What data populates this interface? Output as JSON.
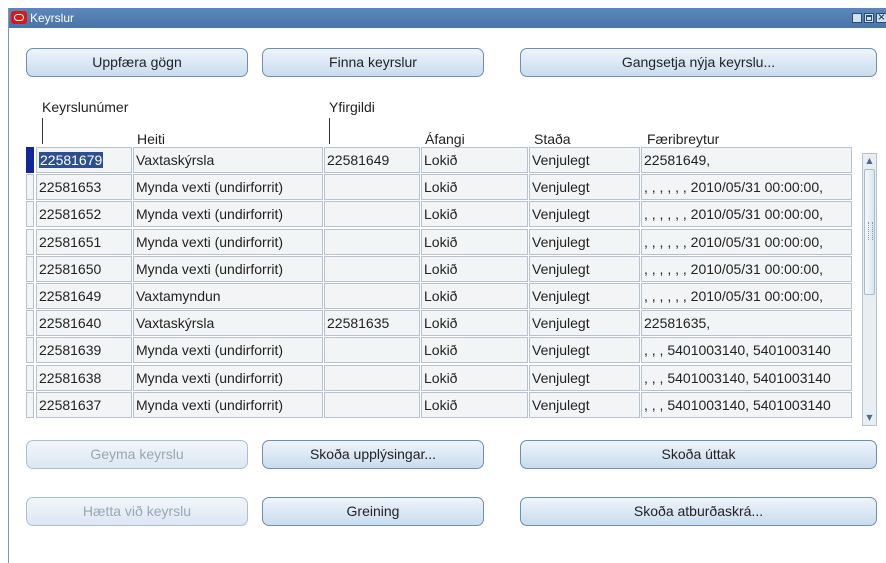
{
  "window": {
    "title": "Keyrslur"
  },
  "top_buttons": {
    "refresh": "Uppfæra gögn",
    "find": "Finna keyrslur",
    "submit_new": "Gangsetja nýja keyrslu..."
  },
  "columns": {
    "request_id": "Keyrslunúmer",
    "name": "Heiti",
    "parent": "Yfirgildi",
    "phase": "Áfangi",
    "status": "Staða",
    "parameters": "Færibreytur"
  },
  "rows": [
    {
      "id": "22581679",
      "name": "Vaxtaskýrsla",
      "parent": "22581649",
      "phase": "Lokið",
      "status": "Venjulegt",
      "params": "22581649,"
    },
    {
      "id": "22581653",
      "name": "Mynda vexti (undirforrit)",
      "parent": "",
      "phase": "Lokið",
      "status": "Venjulegt",
      "params": ", , , , , , 2010/05/31 00:00:00,"
    },
    {
      "id": "22581652",
      "name": "Mynda vexti (undirforrit)",
      "parent": "",
      "phase": "Lokið",
      "status": "Venjulegt",
      "params": ", , , , , , 2010/05/31 00:00:00,"
    },
    {
      "id": "22581651",
      "name": "Mynda vexti (undirforrit)",
      "parent": "",
      "phase": "Lokið",
      "status": "Venjulegt",
      "params": ", , , , , , 2010/05/31 00:00:00,"
    },
    {
      "id": "22581650",
      "name": "Mynda vexti (undirforrit)",
      "parent": "",
      "phase": "Lokið",
      "status": "Venjulegt",
      "params": ", , , , , , 2010/05/31 00:00:00,"
    },
    {
      "id": "22581649",
      "name": "Vaxtamyndun",
      "parent": "",
      "phase": "Lokið",
      "status": "Venjulegt",
      "params": ", , , , , , 2010/05/31 00:00:00,"
    },
    {
      "id": "22581640",
      "name": "Vaxtaskýrsla",
      "parent": "22581635",
      "phase": "Lokið",
      "status": "Venjulegt",
      "params": "22581635,"
    },
    {
      "id": "22581639",
      "name": "Mynda vexti (undirforrit)",
      "parent": "",
      "phase": "Lokið",
      "status": "Venjulegt",
      "params": ", , , 5401003140, 5401003140"
    },
    {
      "id": "22581638",
      "name": "Mynda vexti (undirforrit)",
      "parent": "",
      "phase": "Lokið",
      "status": "Venjulegt",
      "params": ", , , 5401003140, 5401003140"
    },
    {
      "id": "22581637",
      "name": "Mynda vexti (undirforrit)",
      "parent": "",
      "phase": "Lokið",
      "status": "Venjulegt",
      "params": ", , , 5401003140, 5401003140"
    }
  ],
  "bottom_buttons": {
    "hold": "Geyma keyrslu",
    "view_details": "Skoða upplýsingar...",
    "view_output": "Skoða úttak",
    "cancel": "Hætta við keyrslu",
    "diagnostics": "Greining",
    "view_log": "Skoða atburðaskrá..."
  },
  "icons": {
    "app": "oracle-icon",
    "minimize": "minimize-icon",
    "maximize": "maximize-icon",
    "close": "close-icon",
    "scroll_up": "up-arrow-icon",
    "scroll_down": "down-arrow-icon"
  },
  "colors": {
    "titlebar": "#5d87bb",
    "button_border": "#6d8fb5",
    "selection": "#10289b"
  }
}
